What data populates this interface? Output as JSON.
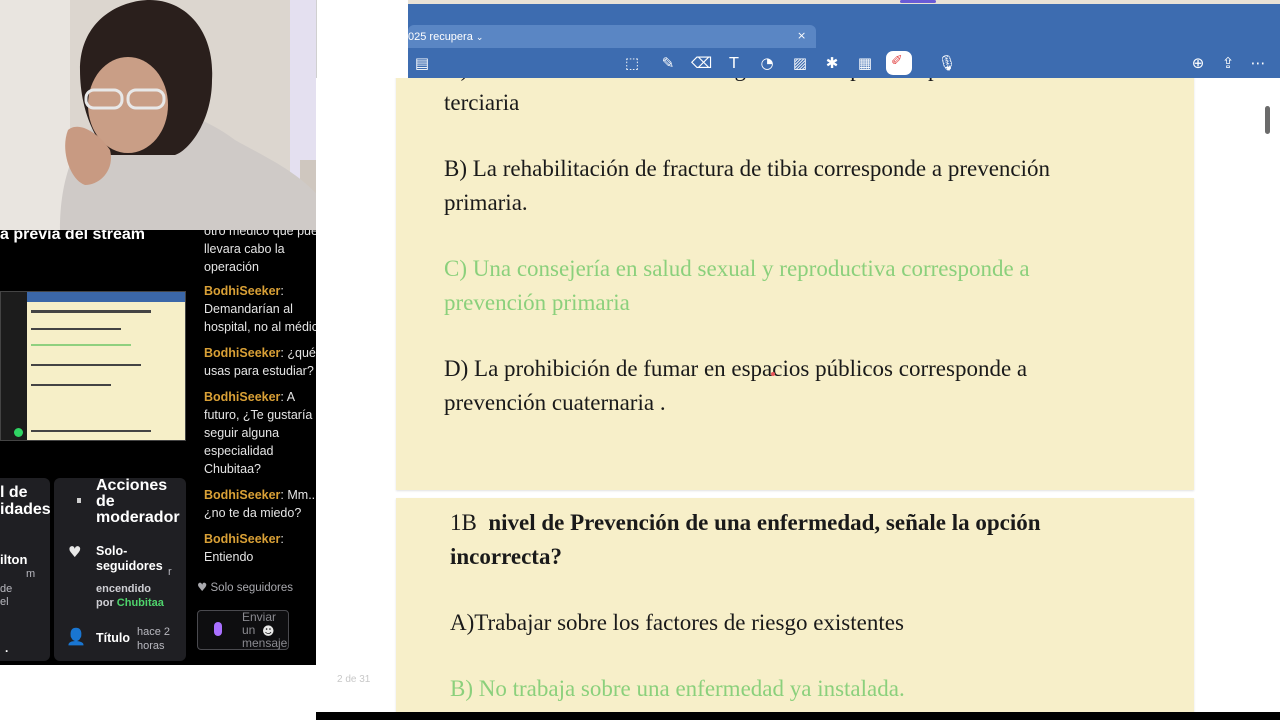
{
  "stream": {
    "preview_title": "a previa del stream",
    "mod_card_1": {
      "title": "l de\nidades",
      "user": "ilton",
      "small_m": "m",
      "lines": "de\nel",
      "dot": "."
    },
    "mod_card_2": {
      "title": "Acciones de moderador",
      "followers_label": "Solo-seguidores",
      "followers_state": "encendido",
      "followers_by_prefix": "por",
      "followers_by_user": "Chubitaa",
      "title_item": "Título",
      "title_time": "hace 2 horas"
    },
    "chat": {
      "messages": [
        {
          "user": "",
          "text": "otro médico que pue llevara cabo la operación"
        },
        {
          "user": "BodhiSeeker",
          "text": "Demandarían al hospital, no al médic"
        },
        {
          "user": "BodhiSeeker",
          "text": "¿qué usas para estudiar?"
        },
        {
          "user": "BodhiSeeker",
          "text": "A futuro, ¿Te gustaría seguir alguna especialidad Chubitaa?"
        },
        {
          "user": "BodhiSeeker",
          "text": "Mm... ¿no te da miedo?"
        },
        {
          "user": "BodhiSeeker",
          "text": "Entiendo"
        }
      ],
      "followers_only": "Solo seguidores",
      "send_placeholder": "Enviar un mensaje",
      "emoji": "☻"
    }
  },
  "app": {
    "tab_label": "025 recupera",
    "page_counter": "2 de 31",
    "accent": "#3d6cb0"
  },
  "doc": {
    "page1": {
      "a_line1": "A) La realización de una mamografía corresponde a prevención",
      "a_line2": "terciaria",
      "b_line1": "B) La rehabilitación de fractura de tibia corresponde a prevención",
      "b_line2": "primaria.",
      "c_line1": "C) Una consejería en salud sexual y reproductiva corresponde a",
      "c_line2": "prevención primaria",
      "d_line1": "D) La prohibición de fumar en espacios públicos corresponde a",
      "d_line2": "prevención cuaternaria ."
    },
    "page2": {
      "q_num": "1B",
      "q_line1": "nivel de  Prevención de una enfermedad, señale la opción",
      "q_line2": "incorrecta?",
      "a": "A)Trabajar sobre los factores de riesgo existentes",
      "b": "B) No trabaja sobre una enfermedad ya instalada."
    }
  }
}
